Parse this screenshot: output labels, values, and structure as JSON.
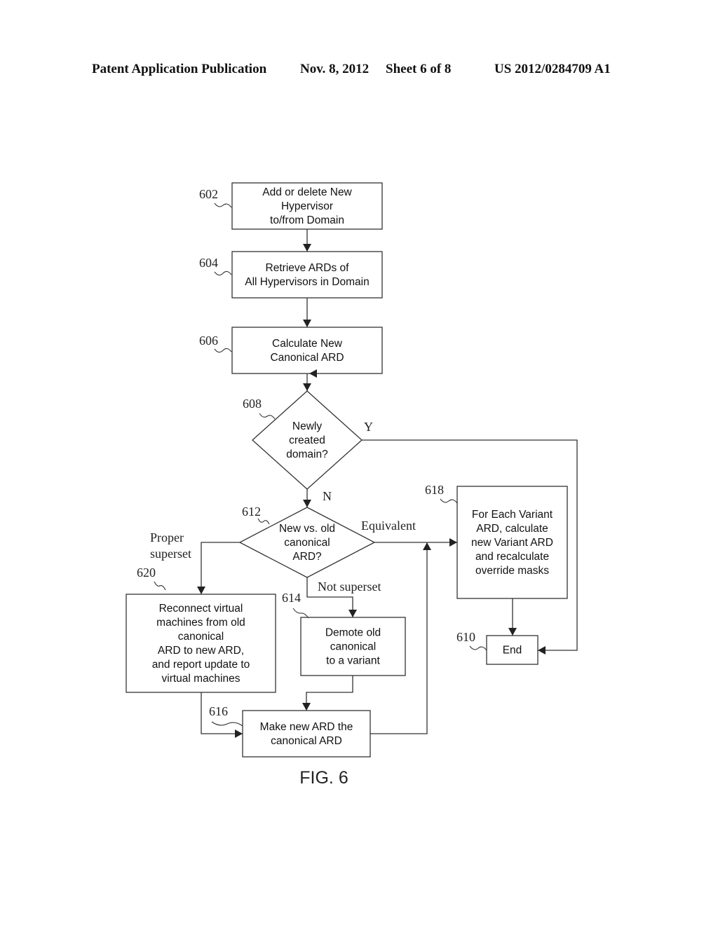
{
  "header": {
    "publication": "Patent Application Publication",
    "date": "Nov. 8, 2012",
    "sheet": "Sheet 6 of 8",
    "number": "US 2012/0284709 A1"
  },
  "figure_label": "FIG. 6",
  "nodes": [
    {
      "id": "602",
      "type": "process",
      "lines": [
        "Add or delete New",
        "Hypervisor",
        "to/from Domain"
      ]
    },
    {
      "id": "604",
      "type": "process",
      "lines": [
        "Retrieve ARDs of",
        "All Hypervisors in Domain"
      ]
    },
    {
      "id": "606",
      "type": "process",
      "lines": [
        "Calculate New",
        "Canonical ARD"
      ]
    },
    {
      "id": "608",
      "type": "decision",
      "lines": [
        "Newly",
        "created",
        "domain?"
      ]
    },
    {
      "id": "612",
      "type": "decision",
      "lines": [
        "New vs. old",
        "canonical",
        "ARD?"
      ]
    },
    {
      "id": "618",
      "type": "process",
      "lines": [
        "For Each Variant",
        "ARD, calculate",
        "new Variant ARD",
        "and recalculate",
        "override masks"
      ]
    },
    {
      "id": "610",
      "type": "terminal",
      "lines": [
        "End"
      ]
    },
    {
      "id": "620",
      "type": "process",
      "lines": [
        "Reconnect virtual",
        "machines from old",
        "canonical",
        "ARD to new ARD,",
        "and report update to",
        "virtual machines"
      ]
    },
    {
      "id": "614",
      "type": "process",
      "lines": [
        "Demote old",
        "canonical",
        "to a variant"
      ]
    },
    {
      "id": "616",
      "type": "process",
      "lines": [
        "Make new ARD the",
        "canonical ARD"
      ]
    }
  ],
  "edges": [
    {
      "from": "602",
      "to": "604",
      "label": ""
    },
    {
      "from": "604",
      "to": "606",
      "label": ""
    },
    {
      "from": "606",
      "to": "608",
      "label": ""
    },
    {
      "from": "608",
      "to": "610",
      "label": "Y"
    },
    {
      "from": "608",
      "to": "612",
      "label": "N"
    },
    {
      "from": "612",
      "to": "618",
      "label": "Equivalent"
    },
    {
      "from": "612",
      "to": "620",
      "label": "Proper superset"
    },
    {
      "from": "612",
      "to": "614",
      "label": "Not superset"
    },
    {
      "from": "620",
      "to": "616",
      "label": ""
    },
    {
      "from": "614",
      "to": "616",
      "label": ""
    },
    {
      "from": "616",
      "to": "618",
      "label": ""
    },
    {
      "from": "618",
      "to": "610",
      "label": ""
    }
  ],
  "edge_labels": {
    "yes": "Y",
    "no": "N",
    "equivalent": "Equivalent",
    "proper_superset": [
      "Proper",
      "superset"
    ],
    "not_superset": "Not superset"
  }
}
